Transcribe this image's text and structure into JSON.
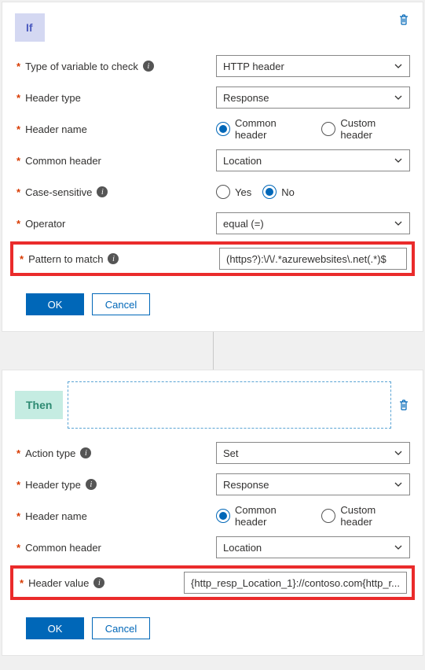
{
  "if": {
    "tag": "If",
    "typeOfVariable": {
      "label": "Type of variable to check",
      "value": "HTTP header"
    },
    "headerType": {
      "label": "Header type",
      "value": "Response"
    },
    "headerName": {
      "label": "Header name",
      "options": {
        "common": "Common header",
        "custom": "Custom header"
      },
      "selected": "common"
    },
    "commonHeader": {
      "label": "Common header",
      "value": "Location"
    },
    "caseSensitive": {
      "label": "Case-sensitive",
      "options": {
        "yes": "Yes",
        "no": "No"
      },
      "selected": "no"
    },
    "operator": {
      "label": "Operator",
      "value": "equal (=)"
    },
    "pattern": {
      "label": "Pattern to match",
      "value": "(https?):\\/\\/.*azurewebsites\\.net(.*)$"
    },
    "buttons": {
      "ok": "OK",
      "cancel": "Cancel"
    }
  },
  "then": {
    "tag": "Then",
    "actionType": {
      "label": "Action type",
      "value": "Set"
    },
    "headerType": {
      "label": "Header type",
      "value": "Response"
    },
    "headerName": {
      "label": "Header name",
      "options": {
        "common": "Common header",
        "custom": "Custom header"
      },
      "selected": "common"
    },
    "commonHeader": {
      "label": "Common header",
      "value": "Location"
    },
    "headerValue": {
      "label": "Header value",
      "value": "{http_resp_Location_1}://contoso.com{http_r..."
    },
    "buttons": {
      "ok": "OK",
      "cancel": "Cancel"
    }
  }
}
